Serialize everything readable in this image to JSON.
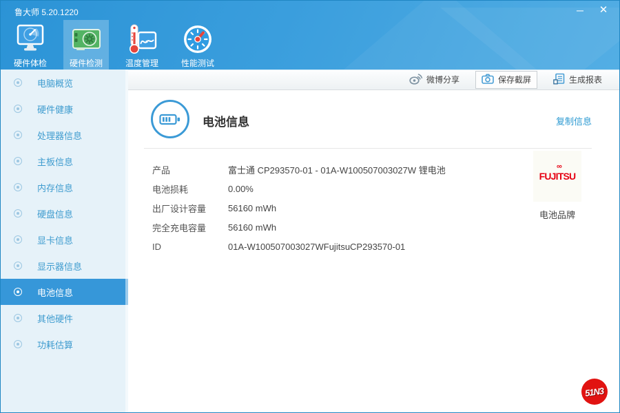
{
  "window": {
    "title": "鲁大师 5.20.1220",
    "minimize_glyph": "─",
    "close_glyph": "✕"
  },
  "nav": {
    "tabs": [
      "硬件体检",
      "硬件检测",
      "温度管理",
      "性能测试"
    ],
    "active_tab": "硬件检测"
  },
  "toolbar": {
    "weibo_share": "微博分享",
    "save_screenshot": "保存截屏",
    "generate_report": "生成报表"
  },
  "sidebar": {
    "items": [
      "电脑概览",
      "硬件健康",
      "处理器信息",
      "主板信息",
      "内存信息",
      "硬盘信息",
      "显卡信息",
      "显示器信息",
      "电池信息",
      "其他硬件",
      "功耗估算"
    ],
    "active_item": "电池信息"
  },
  "main": {
    "title": "电池信息",
    "copy_link": "复制信息",
    "fields": [
      {
        "label": "产品",
        "value": "富士通 CP293570-01 - 01A-W100507003027W 锂电池"
      },
      {
        "label": "电池损耗",
        "value": "0.00%"
      },
      {
        "label": "出厂设计容量",
        "value": "56160 mWh"
      },
      {
        "label": "完全充电容量",
        "value": "56160 mWh"
      },
      {
        "label": "ID",
        "value": "01A-W100507003027WFujitsuCP293570-01"
      }
    ],
    "brand": {
      "name": "FUJITSU",
      "infinity_mark": "∞",
      "caption": "电池品牌"
    }
  },
  "badge": {
    "text": "51N3"
  },
  "colors": {
    "header_blue": "#3a9edd",
    "accent": "#3697d9",
    "link_blue": "#2d9ad2",
    "sidebar_bg": "#e6f2f9",
    "fujitsu_red": "#e60012",
    "badge_red": "#e11311"
  }
}
